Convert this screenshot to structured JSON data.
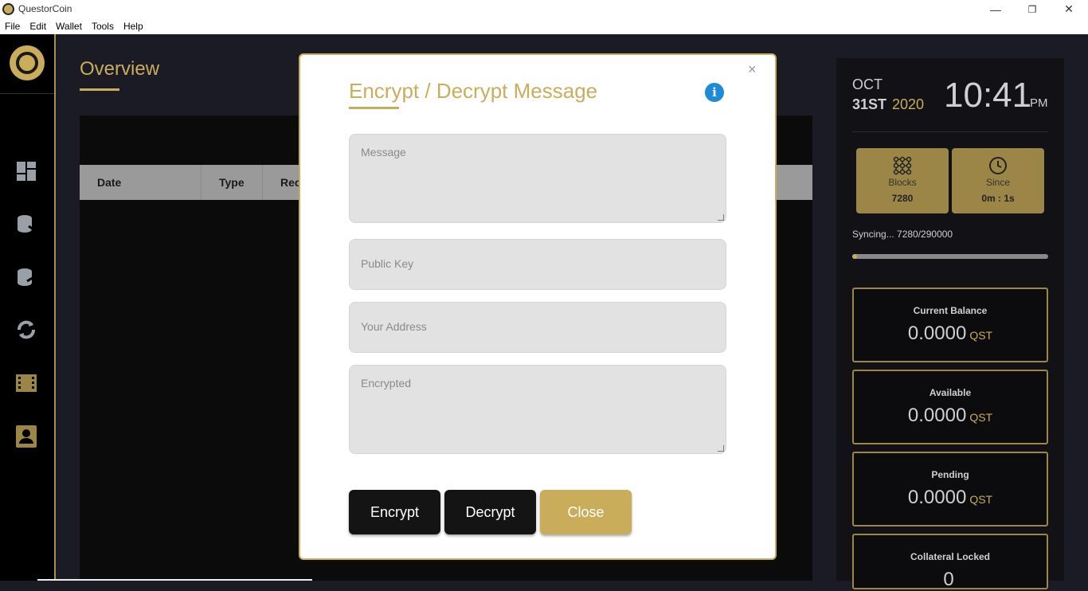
{
  "window": {
    "title": "QuestorCoin",
    "minimize": "—",
    "restore": "❐",
    "close": "✕"
  },
  "menu": [
    "File",
    "Edit",
    "Wallet",
    "Tools",
    "Help"
  ],
  "sidebar": {
    "items": [
      "dashboard-icon",
      "receive-icon",
      "send-icon",
      "exchange-icon",
      "masternode-icon",
      "contacts-icon"
    ]
  },
  "overview": {
    "title": "Overview",
    "columns": [
      "Date",
      "Type",
      "Rec"
    ]
  },
  "clock": {
    "month": "OCT",
    "day": "31ST",
    "year": "2020",
    "time": "10:41",
    "ampm": "PM"
  },
  "stats": {
    "blocks": {
      "label": "Blocks",
      "value": "7280"
    },
    "since": {
      "label": "Since",
      "value": "0m : 1s"
    }
  },
  "sync": {
    "text": "Syncing...  7280/290000",
    "progress": 0.025
  },
  "balances": [
    {
      "label": "Current Balance",
      "amount": "0.0000",
      "unit": "QST"
    },
    {
      "label": "Available",
      "amount": "0.0000",
      "unit": "QST"
    },
    {
      "label": "Pending",
      "amount": "0.0000",
      "unit": "QST"
    },
    {
      "label": "Collateral Locked",
      "amount": "0",
      "unit": ""
    }
  ],
  "modal": {
    "title": "Encrypt / Decrypt Message",
    "close_x": "×",
    "info": "i",
    "message_placeholder": "Message",
    "pubkey_placeholder": "Public Key",
    "address_placeholder": "Your Address",
    "encrypted_placeholder": "Encrypted",
    "encrypt_label": "Encrypt",
    "decrypt_label": "Decrypt",
    "close_label": "Close"
  },
  "colors": {
    "gold": "#c9ad5b",
    "dark": "#141414",
    "info_blue": "#1f8ad6"
  }
}
